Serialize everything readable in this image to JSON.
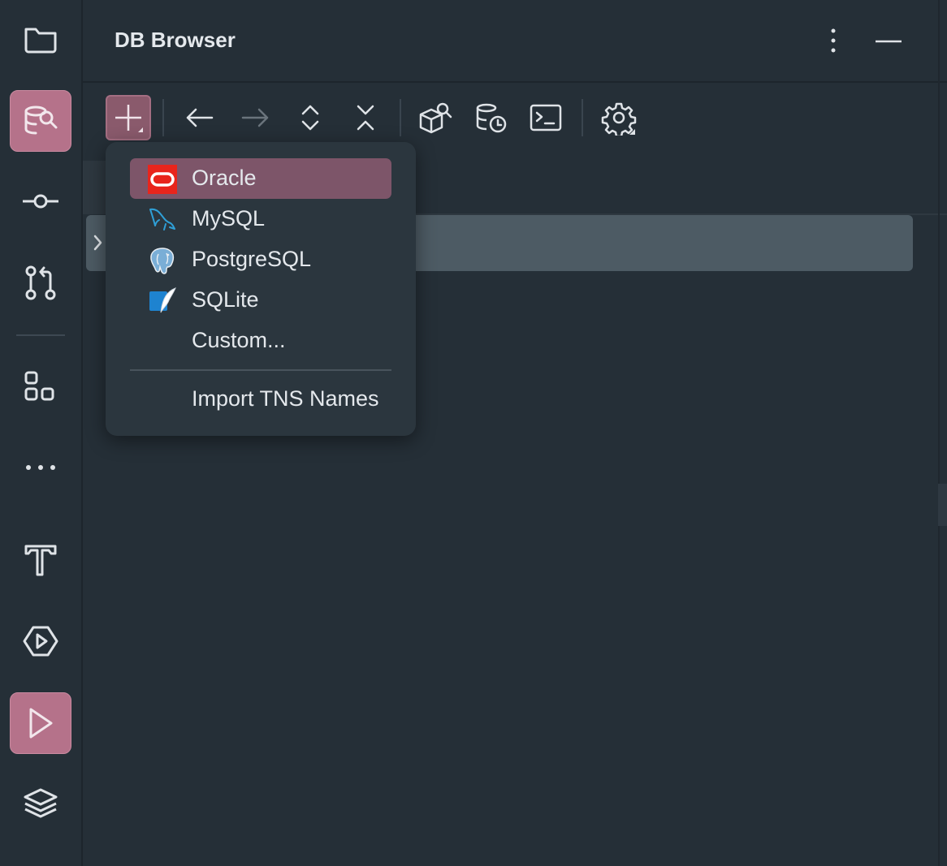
{
  "app": {
    "panel_title": "DB Browser"
  },
  "colors": {
    "accent": "#b5728a",
    "menu_selected": "#7d5569",
    "background": "#252f37"
  },
  "sidebar": {
    "items": [
      {
        "name": "folder-icon",
        "active": false
      },
      {
        "name": "db-browser-icon",
        "active": true
      },
      {
        "name": "commit-icon",
        "active": false
      },
      {
        "name": "pull-request-icon",
        "active": false
      },
      {
        "name": "plugins-icon",
        "active": false
      },
      {
        "name": "more-icon",
        "active": false
      },
      {
        "name": "build-hammer-icon",
        "active": false
      },
      {
        "name": "services-icon",
        "active": false
      },
      {
        "name": "run-icon",
        "active": true
      },
      {
        "name": "layers-icon",
        "active": false
      }
    ]
  },
  "header": {
    "actions": [
      "more-vertical-icon",
      "minimize-icon"
    ]
  },
  "toolbar": {
    "buttons": [
      "add-icon",
      "back-arrow-icon",
      "forward-arrow-icon",
      "expand-all-icon",
      "collapse-all-icon",
      "find-object-icon",
      "history-icon",
      "console-icon",
      "settings-icon"
    ]
  },
  "menu": {
    "items": [
      {
        "label": "Oracle",
        "icon": "oracle-icon",
        "selected": true
      },
      {
        "label": "MySQL",
        "icon": "mysql-icon",
        "selected": false
      },
      {
        "label": "PostgreSQL",
        "icon": "postgresql-icon",
        "selected": false
      },
      {
        "label": "SQLite",
        "icon": "sqlite-icon",
        "selected": false
      },
      {
        "label": "Custom...",
        "icon": "",
        "selected": false
      }
    ],
    "import_label": "Import TNS Names"
  }
}
